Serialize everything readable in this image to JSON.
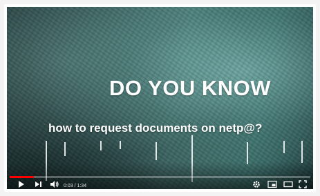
{
  "video": {
    "headline": "DO YOU KNOW",
    "subline": "how to request documents on netp@?",
    "progress_fraction": 0.08
  },
  "controls": {
    "time_display": "0:03 / 1:34",
    "icons": [
      "play-icon",
      "next-icon",
      "volume-icon",
      "settings-icon",
      "miniplayer-icon",
      "theater-icon",
      "fullscreen-icon"
    ]
  },
  "colors": {
    "progress": "#ff0000",
    "text": "#ffffff"
  }
}
